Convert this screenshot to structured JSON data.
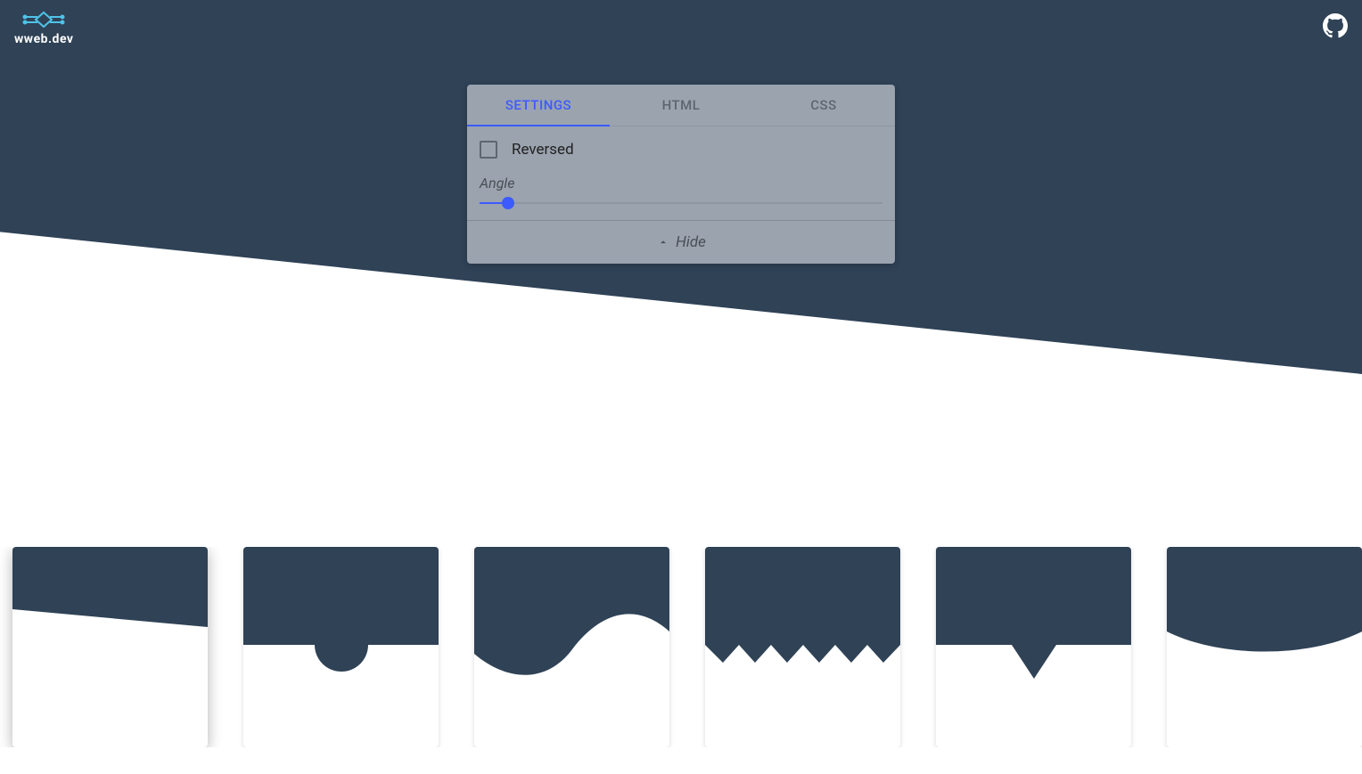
{
  "brand": {
    "name": "wweb.dev"
  },
  "colors": {
    "primary": "#2f4256",
    "accent": "#3d5afe",
    "panel_bg": "rgba(195, 201, 208, 0.72)"
  },
  "panel": {
    "tabs": [
      {
        "label": "SETTINGS",
        "active": true
      },
      {
        "label": "HTML",
        "active": false
      },
      {
        "label": "CSS",
        "active": false
      }
    ],
    "settings": {
      "reversed_label": "Reversed",
      "reversed_checked": false,
      "angle_label": "Angle",
      "angle_value": 7
    },
    "footer": {
      "label": "Hide"
    }
  },
  "separators": [
    {
      "name": "skew",
      "active": true
    },
    {
      "name": "semi-circle",
      "active": false
    },
    {
      "name": "wave",
      "active": false
    },
    {
      "name": "zigzag",
      "active": false
    },
    {
      "name": "triangle",
      "active": false
    },
    {
      "name": "curve",
      "active": false
    }
  ]
}
